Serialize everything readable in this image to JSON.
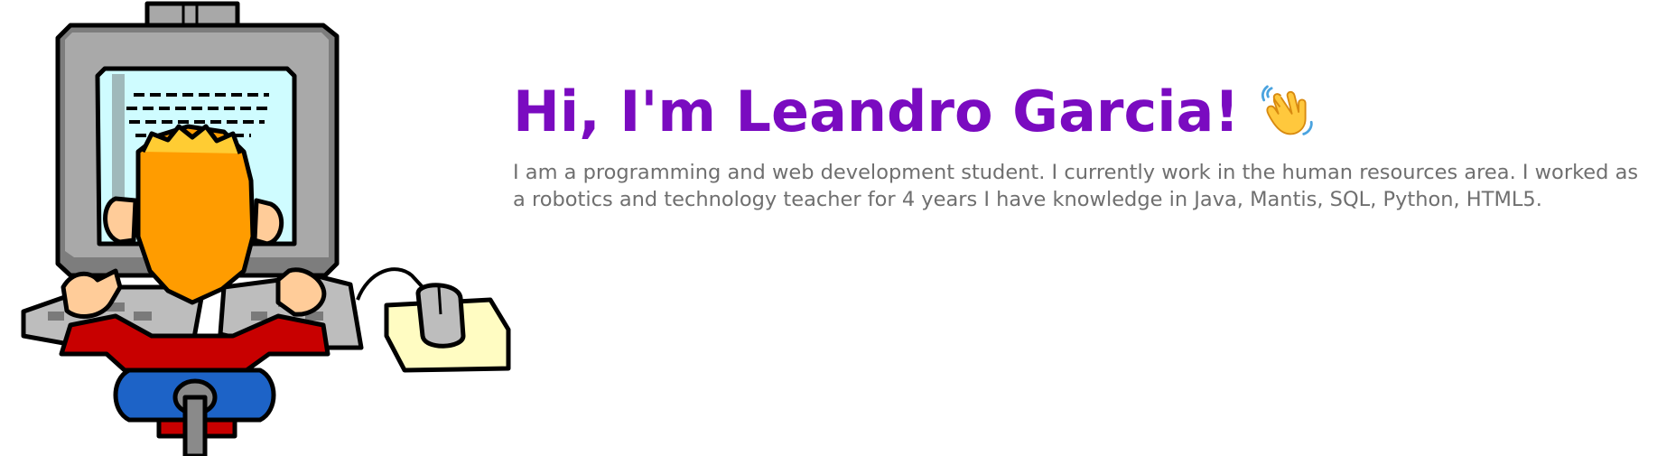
{
  "hero": {
    "illustration_name": "retro-programmer-at-computer",
    "title": "Hi, I'm Leandro Garcia!",
    "wave_icon": "waving-hand-icon",
    "intro": "I am a programming and web development student. I currently work in the human resources area. I worked as a robotics and technology teacher for 4 years I have knowledge in Java, Mantis, SQL, Python, HTML5.",
    "colors": {
      "title": "#7a0bc0",
      "body_text": "#6f6f6f",
      "background": "#ffffff"
    }
  }
}
